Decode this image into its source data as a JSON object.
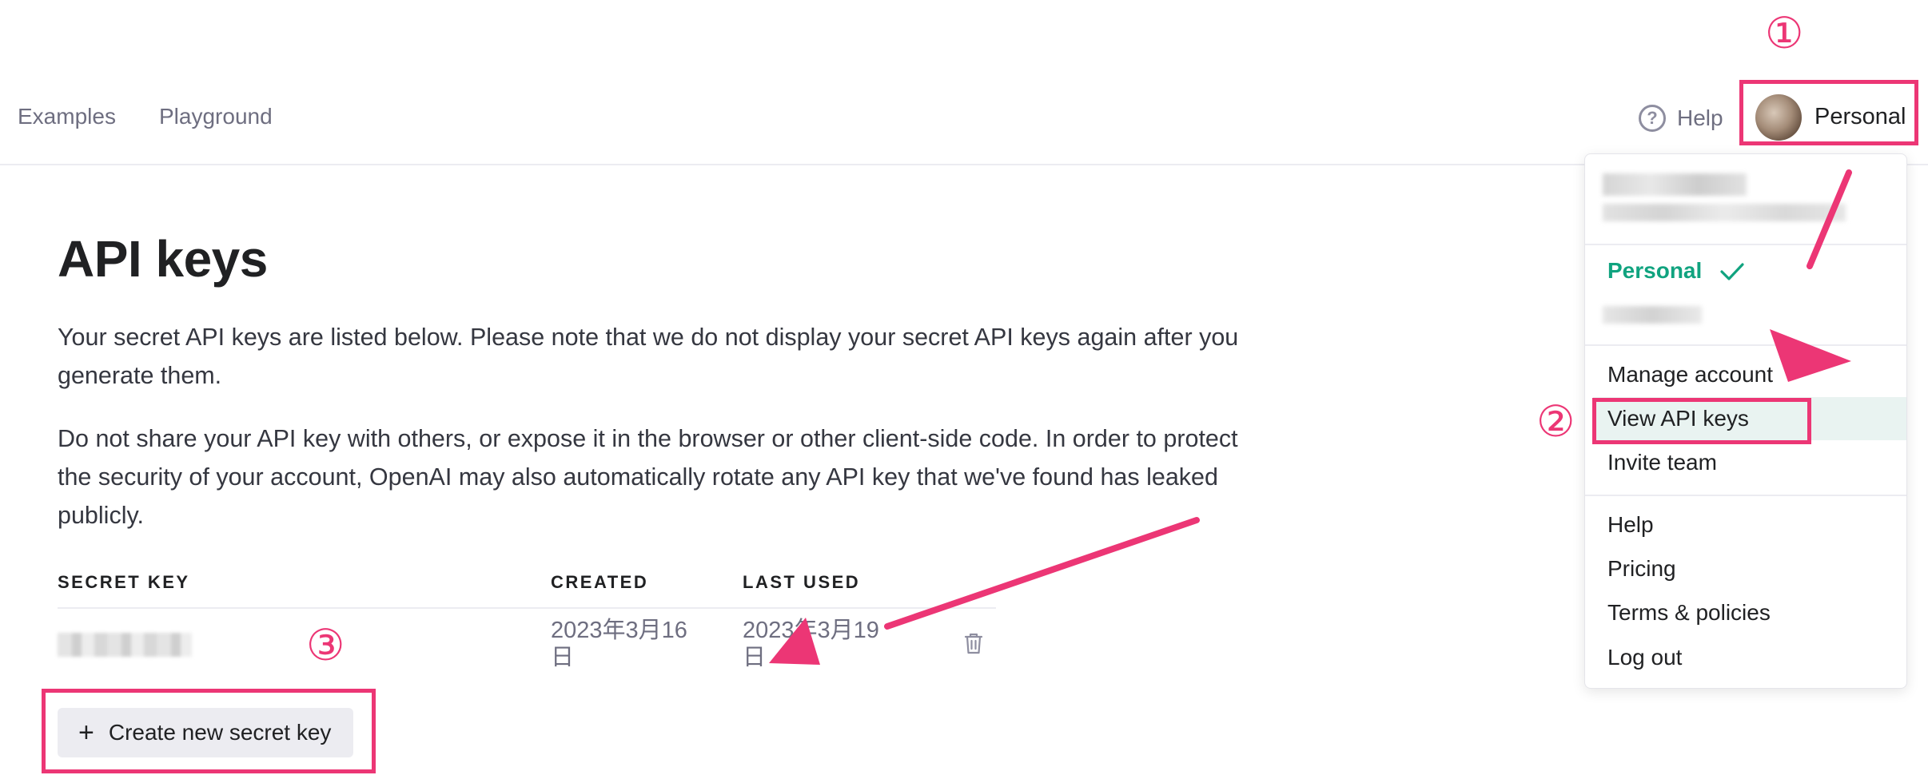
{
  "nav": {
    "examples": "Examples",
    "playground": "Playground",
    "help": "Help",
    "org_name": "Personal"
  },
  "page": {
    "title": "API keys",
    "intro": "Your secret API keys are listed below. Please note that we do not display your secret API keys again after you generate them.",
    "warning": "Do not share your API key with others, or expose it in the browser or other client-side code. In order to protect the security of your account, OpenAI may also automatically rotate any API key that we've found has leaked publicly."
  },
  "table": {
    "headers": [
      "SECRET KEY",
      "CREATED",
      "LAST USED"
    ],
    "rows": [
      {
        "created": "2023年3月16日",
        "last_used": "2023年3月19日"
      }
    ]
  },
  "create_button": {
    "label": "Create new secret key"
  },
  "menu": {
    "active_org": "Personal",
    "items": [
      "Manage account",
      "View API keys",
      "Invite team",
      "Help",
      "Pricing",
      "Terms & policies",
      "Log out"
    ]
  },
  "annotations": {
    "step1": "①",
    "step2": "②",
    "step3": "③"
  },
  "colors": {
    "accent_green": "#10a37f",
    "annotation_pink": "#ec3675",
    "menu_highlight": "#e9f3f1"
  },
  "icons": [
    "help-icon",
    "avatar",
    "checkmark-icon",
    "trash-icon",
    "plus-icon"
  ]
}
